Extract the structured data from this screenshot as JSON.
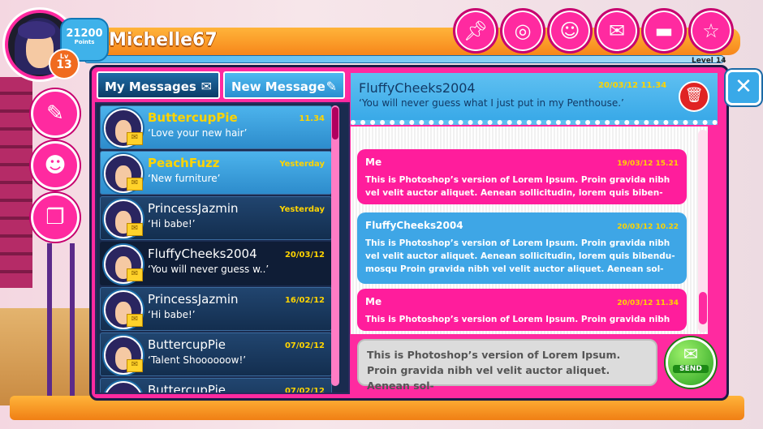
{
  "profile": {
    "username": "Michelle67",
    "points": "21200",
    "points_label": "Points",
    "level_label": "Lv",
    "level": "13",
    "next_level": "Level 14",
    "xp_progress": 0.97
  },
  "top_icons": [
    "pin-icon",
    "globe-icon",
    "smiley-icon",
    "envelope-icon",
    "lips-icon",
    "star-icon"
  ],
  "side_icons": [
    "paintbrush-icon",
    "profile-icon",
    "gift-icon"
  ],
  "tabs": {
    "my_messages": "My Messages",
    "new_message": "New Message"
  },
  "messages": [
    {
      "sender": "ButtercupPie",
      "preview": "‘Love your new hair’",
      "time": "11.34",
      "unread": true
    },
    {
      "sender": "PeachFuzz",
      "preview": "‘New furniture’",
      "time": "Yesterday",
      "unread": true
    },
    {
      "sender": "PrincessJazmin",
      "preview": "‘Hi babe!’",
      "time": "Yesterday",
      "unread": false
    },
    {
      "sender": "FluffyCheeks2004",
      "preview": "‘You will never guess w..’",
      "time": "20/03/12",
      "unread": false,
      "active": true
    },
    {
      "sender": "PrincessJazmin",
      "preview": "‘Hi babe!’",
      "time": "16/02/12",
      "unread": false
    },
    {
      "sender": "ButtercupPie",
      "preview": "‘Talent Shoooooow!’",
      "time": "07/02/12",
      "unread": false
    },
    {
      "sender": "ButtercupPie",
      "preview": "",
      "time": "07/02/12",
      "unread": false
    }
  ],
  "conversation": {
    "with": "FluffyCheeks2004",
    "date": "20/03/12 11.34",
    "subject": "‘You will never guess what I just put in my Penthouse.’",
    "bubbles": [
      {
        "from": "Me",
        "date": "19/03/12 15.21",
        "text": "This is Photoshop’s version  of Lorem Ipsum. Proin gravida nibh vel velit auctor aliquet. Aenean sollicitudin, lorem quis biben-"
      },
      {
        "from": "FluffyCheeks2004",
        "date": "20/03/12 10.22",
        "text": "This is Photoshop’s version  of Lorem Ipsum. Proin gravida nibh vel velit auctor aliquet. Aenean sollicitudin, lorem quis bibendu-mosqu Proin gravida nibh vel velit auctor aliquet. Aenean sol-"
      },
      {
        "from": "Me",
        "date": "20/03/12 11.34",
        "text": "This is Photoshop’s version  of Lorem Ipsum. Proin gravida nibh"
      }
    ]
  },
  "compose": {
    "text": "This is Photoshop’s version of Lorem Ipsum. Proin gravida nibh vel velit auctor aliquet. Aenean sol-",
    "send_label": "SEND"
  },
  "colors": {
    "pink": "#ff2aa0",
    "blue": "#39a9e8",
    "orange": "#f7861a",
    "navy": "#132e4f",
    "yellow": "#ffd400"
  }
}
